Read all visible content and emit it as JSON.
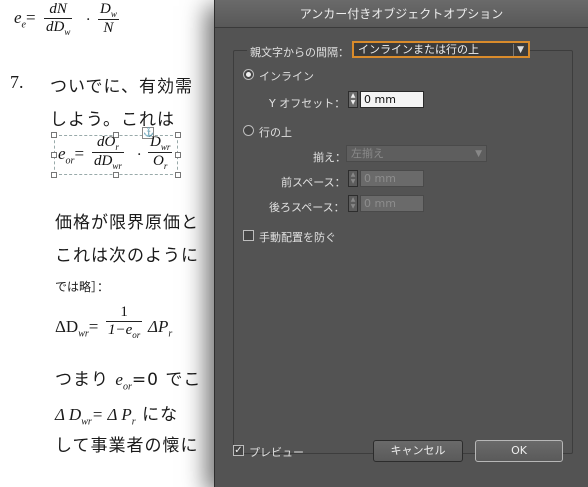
{
  "document": {
    "eq1": {
      "lhs": "e",
      "lhs_sub": "e",
      "frac1_num": "dN",
      "frac1_den": "dD",
      "frac1_den_sub": "w",
      "dot": "·",
      "frac2_num": "D",
      "frac2_num_sub": "w",
      "frac2_den": "N"
    },
    "item_number": "7.",
    "line1": "ついでに、有効需",
    "line2": "しよう。これは",
    "eq2": {
      "lhs": "e",
      "lhs_sub": "or",
      "frac1_num": "dO",
      "frac1_num_sub": "r",
      "frac1_den": "dD",
      "frac1_den_sub": "wr",
      "dot": "·",
      "frac2_num": "D",
      "frac2_num_sub": "wr",
      "frac2_den": "O",
      "frac2_den_sub": "r"
    },
    "line3": "価格が限界原価と",
    "line4": "これは次のように",
    "line5": "では略］：",
    "eq3": {
      "lhs": "ΔD",
      "lhs_sub": "wr",
      "eq": "=",
      "num": "1",
      "den": "1−e",
      "den_sub": "or",
      "rhs": "ΔP",
      "rhs_sub": "r"
    },
    "line6_pre": "つまり",
    "line6_math": "e",
    "line6_sub": "or",
    "line6_post": "=0 でこ",
    "line7_pre": "Δ D",
    "line7_sub": "wr",
    "line7_mid": "= Δ P",
    "line7_sub2": "r",
    "line7_post": " にな",
    "line8": "して事業者の懐に"
  },
  "dialog": {
    "title": "アンカー付きオブジェクトオプション",
    "position_label": "親文字からの間隔：",
    "position_value": "インラインまたは行の上",
    "inline_label": "インライン",
    "y_offset_label": "Y オフセット：",
    "y_offset_value": "0 mm",
    "above_line_label": "行の上",
    "align_label": "揃え：",
    "align_value": "左揃え",
    "space_before_label": "前スペース：",
    "space_before_value": "0 mm",
    "space_after_label": "後ろスペース：",
    "space_after_value": "0 mm",
    "prevent_manual_label": "手動配置を防ぐ",
    "preview_label": "プレビュー",
    "cancel_label": "キャンセル",
    "ok_label": "OK"
  }
}
